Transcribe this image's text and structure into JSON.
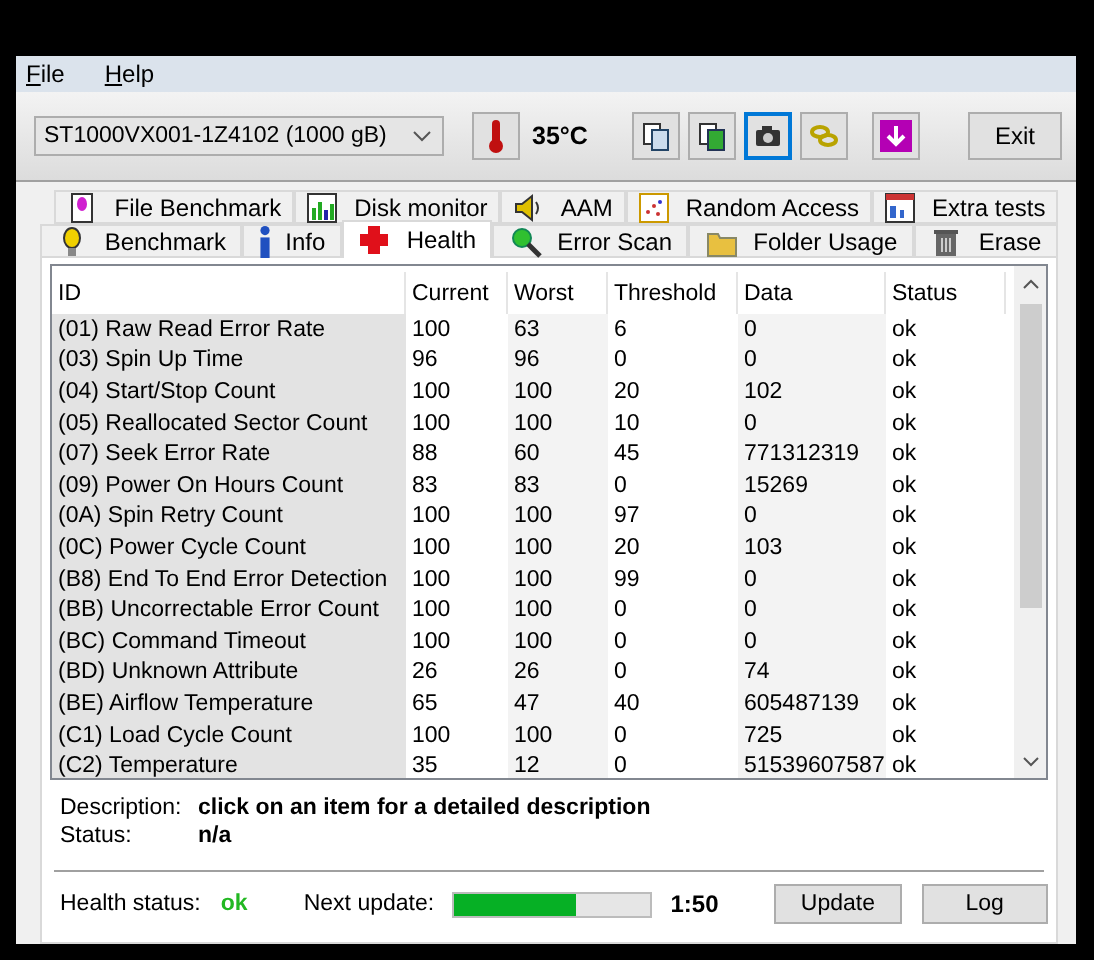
{
  "menu": [
    "File",
    "Help"
  ],
  "drive": {
    "value": "ST1000VX001-1Z4102 (1000 gB)"
  },
  "temperature": "35°C",
  "toolbar_buttons": [
    {
      "selected": false
    },
    {
      "selected": false
    },
    {
      "selected": true
    },
    {
      "selected": false
    },
    {
      "selected": false
    }
  ],
  "exit_button": "Exit",
  "tab_rows": [
    [
      {
        "label": "File Benchmark",
        "selected": false
      },
      {
        "label": "Disk monitor",
        "selected": false
      },
      {
        "label": "AAM",
        "selected": false
      },
      {
        "label": "Random Access",
        "selected": false
      },
      {
        "label": "Extra tests",
        "selected": false
      }
    ],
    [
      {
        "label": "Benchmark",
        "selected": false
      },
      {
        "label": "Info",
        "selected": false
      },
      {
        "label": "Health",
        "selected": true
      },
      {
        "label": "Error Scan",
        "selected": false
      },
      {
        "label": "Folder Usage",
        "selected": false
      },
      {
        "label": "Erase",
        "selected": false
      }
    ]
  ],
  "table": {
    "columns": [
      "ID",
      "Current",
      "Worst",
      "Threshold",
      "Data",
      "Status"
    ],
    "rows": [
      [
        "(01) Raw Read Error Rate",
        "100",
        "63",
        "6",
        "0",
        "ok"
      ],
      [
        "(03) Spin Up Time",
        "96",
        "96",
        "0",
        "0",
        "ok"
      ],
      [
        "(04) Start/Stop Count",
        "100",
        "100",
        "20",
        "102",
        "ok"
      ],
      [
        "(05) Reallocated Sector Count",
        "100",
        "100",
        "10",
        "0",
        "ok"
      ],
      [
        "(07) Seek Error Rate",
        "88",
        "60",
        "45",
        "771312319",
        "ok"
      ],
      [
        "(09) Power On Hours Count",
        "83",
        "83",
        "0",
        "15269",
        "ok"
      ],
      [
        "(0A) Spin Retry Count",
        "100",
        "100",
        "97",
        "0",
        "ok"
      ],
      [
        "(0C) Power Cycle Count",
        "100",
        "100",
        "20",
        "103",
        "ok"
      ],
      [
        "(B8) End To End Error Detection",
        "100",
        "100",
        "99",
        "0",
        "ok"
      ],
      [
        "(BB) Uncorrectable Error Count",
        "100",
        "100",
        "0",
        "0",
        "ok"
      ],
      [
        "(BC) Command Timeout",
        "100",
        "100",
        "0",
        "0",
        "ok"
      ],
      [
        "(BD) Unknown Attribute",
        "26",
        "26",
        "0",
        "74",
        "ok"
      ],
      [
        "(BE) Airflow Temperature",
        "65",
        "47",
        "40",
        "605487139",
        "ok"
      ],
      [
        "(C1) Load Cycle Count",
        "100",
        "100",
        "0",
        "725",
        "ok"
      ],
      [
        "(C2) Temperature",
        "35",
        "12",
        "0",
        "51539607587",
        "ok"
      ]
    ]
  },
  "details": [
    {
      "label": "Description:",
      "value": "click on an item for a detailed description"
    },
    {
      "label": "Status:",
      "value": "n/a"
    }
  ],
  "status_bar": {
    "health_label": "Health status:",
    "health_value": "ok",
    "next_update_label": "Next update:",
    "level": 0.62,
    "countdown": "1:50",
    "buttons": [
      "Update",
      "Log"
    ]
  }
}
